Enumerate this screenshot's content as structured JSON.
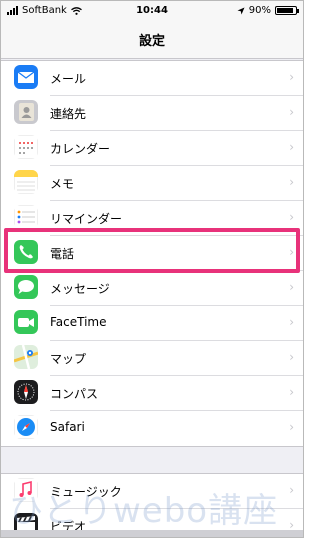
{
  "status_bar": {
    "carrier": "SoftBank",
    "time": "10:44",
    "battery": "90%",
    "battery_level": 0.9
  },
  "nav": {
    "title": "設定"
  },
  "group1": [
    {
      "label": "メール",
      "icon": "mail-icon",
      "color": "#1a7cf5"
    },
    {
      "label": "連絡先",
      "icon": "contacts-icon",
      "color": "#b5b5b5"
    },
    {
      "label": "カレンダー",
      "icon": "calendar-icon",
      "color": "#ffffff"
    },
    {
      "label": "メモ",
      "icon": "notes-icon",
      "color": "#ffd54a"
    },
    {
      "label": "リマインダー",
      "icon": "reminders-icon",
      "color": "#ffffff"
    },
    {
      "label": "電話",
      "icon": "phone-icon",
      "color": "#34c759"
    },
    {
      "label": "メッセージ",
      "icon": "messages-icon",
      "color": "#34c759"
    },
    {
      "label": "FaceTime",
      "icon": "facetime-icon",
      "color": "#34c759"
    },
    {
      "label": "マップ",
      "icon": "maps-icon",
      "color": "#7ec87e"
    },
    {
      "label": "コンパス",
      "icon": "compass-icon",
      "color": "#1c1c1e"
    },
    {
      "label": "Safari",
      "icon": "safari-icon",
      "color": "#ffffff"
    }
  ],
  "group2": [
    {
      "label": "ミュージック",
      "icon": "music-icon",
      "color": "#ffffff"
    },
    {
      "label": "ビデオ",
      "icon": "videos-icon",
      "color": "#1c1c1e"
    }
  ],
  "highlighted": "電話",
  "watermark": "ひとりwebo講座",
  "colors": {
    "highlight": "#e8327a",
    "background": "#efeff4"
  }
}
